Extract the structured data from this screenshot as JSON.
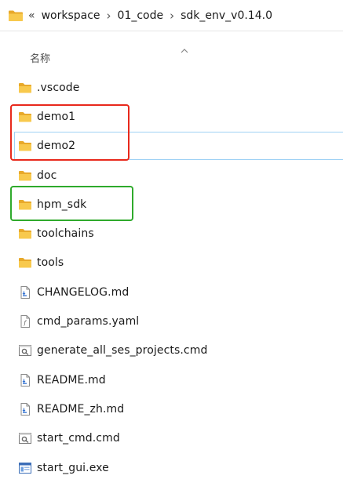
{
  "address_bar": {
    "overflow_label": "«",
    "breadcrumbs": [
      "workspace",
      "01_code",
      "sdk_env_v0.14.0"
    ],
    "separator": "›"
  },
  "column_header": {
    "name_label": "名称",
    "sort_icon": "chevron-up-icon"
  },
  "files": [
    {
      "name": ".vscode",
      "type": "folder",
      "icon": "folder-icon"
    },
    {
      "name": "demo1",
      "type": "folder",
      "icon": "folder-icon"
    },
    {
      "name": "demo2",
      "type": "folder",
      "icon": "folder-icon"
    },
    {
      "name": "doc",
      "type": "folder",
      "icon": "folder-icon"
    },
    {
      "name": "hpm_sdk",
      "type": "folder",
      "icon": "folder-icon"
    },
    {
      "name": "toolchains",
      "type": "folder",
      "icon": "folder-icon"
    },
    {
      "name": "tools",
      "type": "folder",
      "icon": "folder-icon"
    },
    {
      "name": "CHANGELOG.md",
      "type": "markdown",
      "icon": "markdown-file-icon"
    },
    {
      "name": "cmd_params.yaml",
      "type": "yaml",
      "icon": "text-file-icon"
    },
    {
      "name": "generate_all_ses_projects.cmd",
      "type": "cmd",
      "icon": "script-file-icon"
    },
    {
      "name": "README.md",
      "type": "markdown",
      "icon": "markdown-file-icon"
    },
    {
      "name": "README_zh.md",
      "type": "markdown",
      "icon": "markdown-file-icon"
    },
    {
      "name": "start_cmd.cmd",
      "type": "cmd",
      "icon": "script-file-icon"
    },
    {
      "name": "start_gui.exe",
      "type": "exe",
      "icon": "exe-file-icon"
    }
  ],
  "annotations": {
    "red_box_color": "#e8291c",
    "green_box_color": "#2faa2c",
    "hover_color": "#9fd2f5"
  },
  "colors": {
    "folder_fill": "#f8c94d",
    "folder_tab": "#e8a92a"
  }
}
